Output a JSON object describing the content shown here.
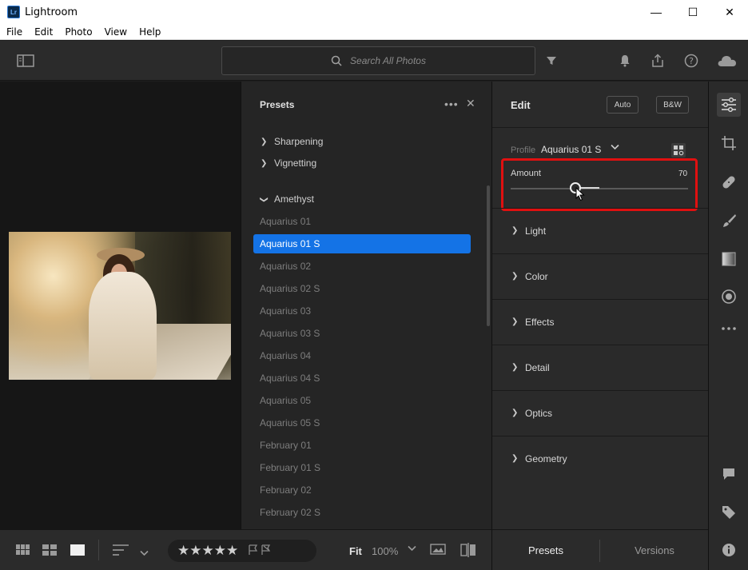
{
  "window": {
    "title": "Lightroom",
    "logo_text": "Lr",
    "minimize": "—",
    "maximize": "☐",
    "close": "✕"
  },
  "menu": [
    "File",
    "Edit",
    "Photo",
    "View",
    "Help"
  ],
  "toolbar": {
    "search_placeholder": "Search All Photos"
  },
  "presets": {
    "header": "Presets",
    "more": "•••",
    "close": "✕",
    "groups": [
      {
        "label": "Sharpening",
        "expanded": false
      },
      {
        "label": "Vignetting",
        "expanded": false
      },
      {
        "label": "Amethyst",
        "expanded": true
      }
    ],
    "items": [
      "Aquarius 01",
      "Aquarius 01 S",
      "Aquarius 02",
      "Aquarius 02 S",
      "Aquarius 03",
      "Aquarius 03 S",
      "Aquarius 04",
      "Aquarius 04 S",
      "Aquarius 05",
      "Aquarius 05 S",
      "February 01",
      "February 01 S",
      "February 02",
      "February 02 S"
    ],
    "selected": "Aquarius 01 S"
  },
  "edit": {
    "title": "Edit",
    "auto_label": "Auto",
    "bw_label": "B&W",
    "profile_label": "Profile",
    "profile_value": "Aquarius 01 S",
    "amount_label": "Amount",
    "amount_value": "70",
    "sections": [
      "Light",
      "Color",
      "Effects",
      "Detail",
      "Optics",
      "Geometry"
    ]
  },
  "bottom": {
    "fit_label": "Fit",
    "zoom_label": "100%",
    "stars": "★★★★★",
    "tab_presets": "Presets",
    "tab_versions": "Versions"
  },
  "colors": {
    "accent": "#1473e6",
    "highlight": "#e01010"
  }
}
